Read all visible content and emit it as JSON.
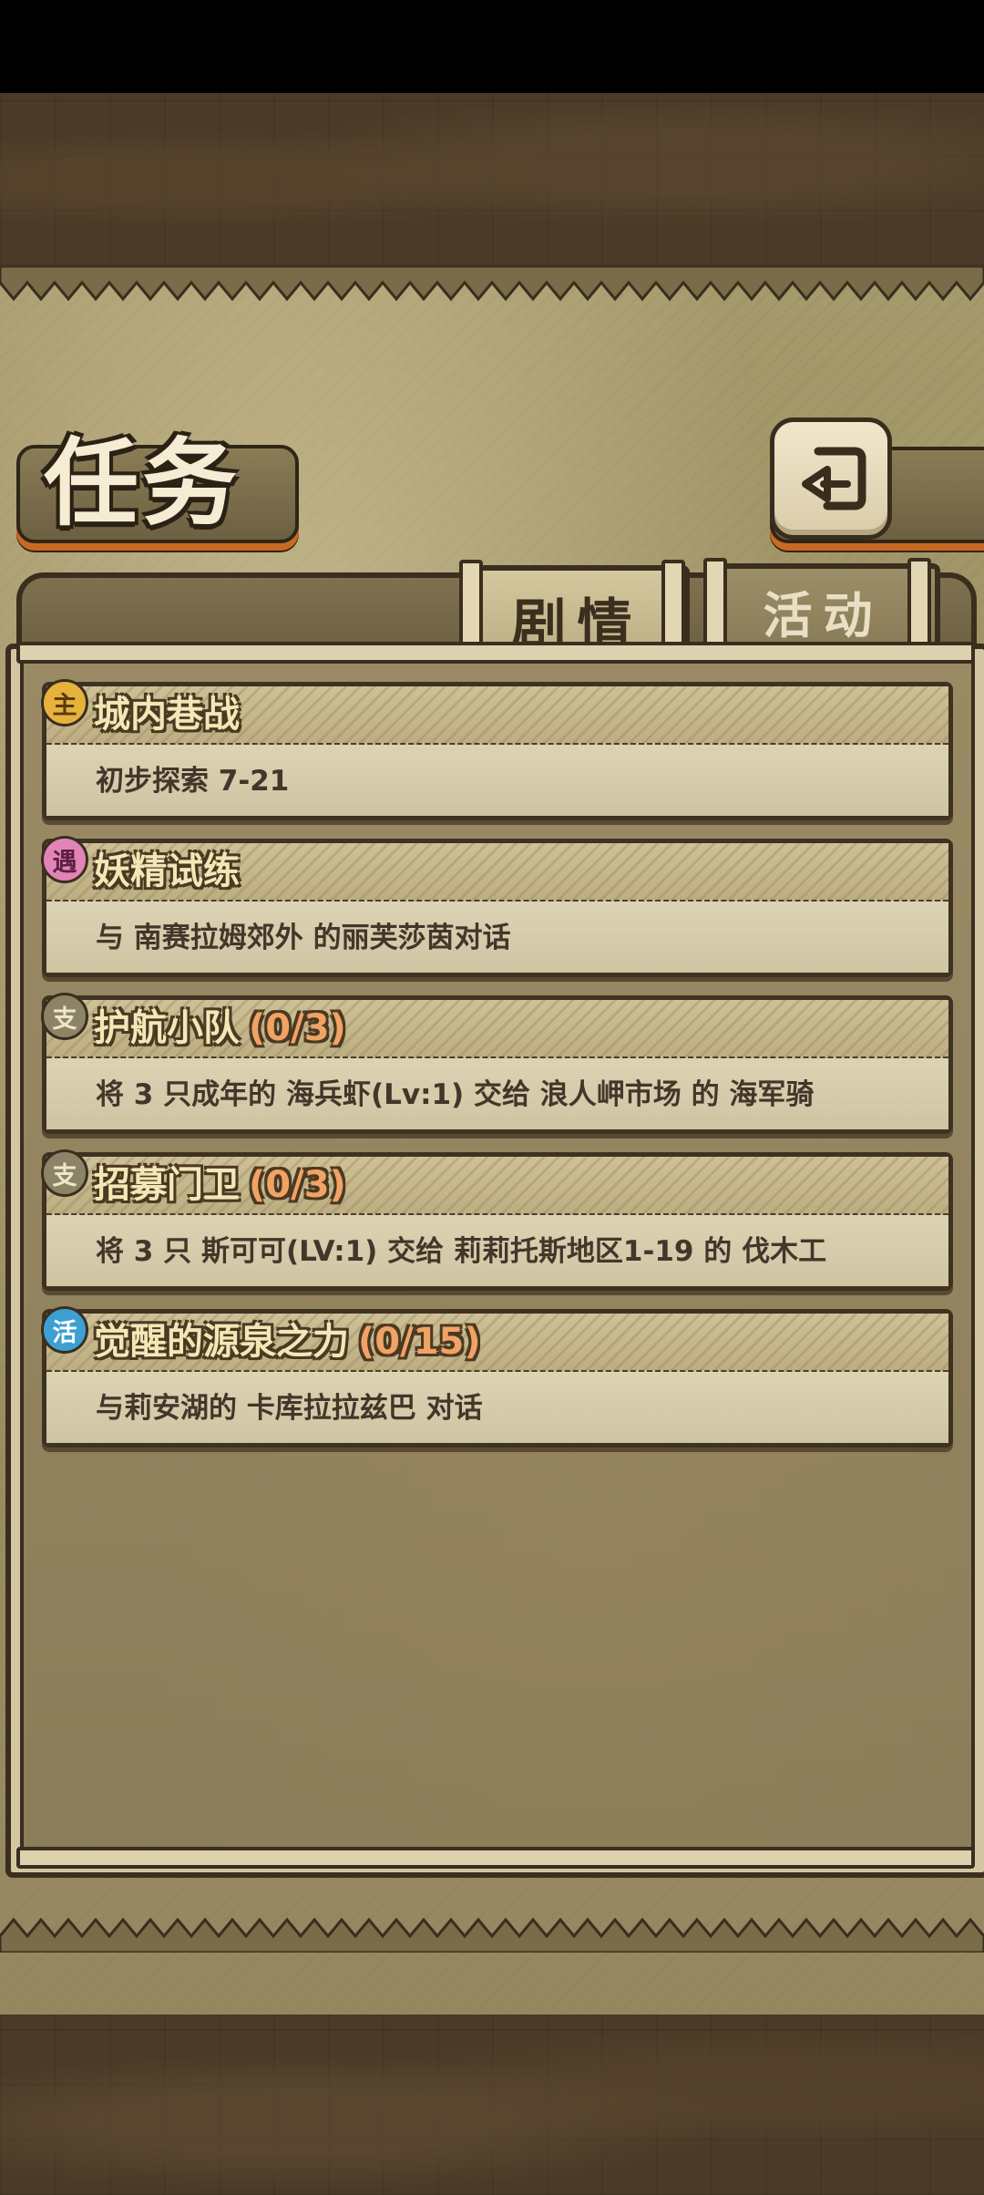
{
  "header": {
    "title": "任务",
    "back_icon": "return-arrow-icon"
  },
  "tabs": [
    {
      "label": "剧情",
      "selected": true
    },
    {
      "label": "活动",
      "selected": false
    }
  ],
  "quests": [
    {
      "badge": "主",
      "badge_color": "#e7b23c",
      "title": "城内巷战",
      "progress": "",
      "description": "初步探索 7-21"
    },
    {
      "badge": "遇",
      "badge_color": "#e284b6",
      "title": "妖精试练",
      "progress": "",
      "description": "与 南赛拉姆郊外 的丽芙莎茵对话"
    },
    {
      "badge": "支",
      "badge_color": "#8d8468",
      "title": "护航小队",
      "progress": "(0/3)",
      "description": "将 3 只成年的 海兵虾(Lv:1) 交给 浪人岬市场 的 海军骑"
    },
    {
      "badge": "支",
      "badge_color": "#8d8468",
      "title": "招募门卫",
      "progress": "(0/3)",
      "description": "将 3 只 斯可可(LV:1) 交给 莉莉托斯地区1-19 的 伐木工"
    },
    {
      "badge": "活",
      "badge_color": "#3d9fd4",
      "title": "觉醒的源泉之力",
      "progress": "(0/15)",
      "description": "与莉安湖的 卡库拉拉兹巴 对话"
    }
  ]
}
